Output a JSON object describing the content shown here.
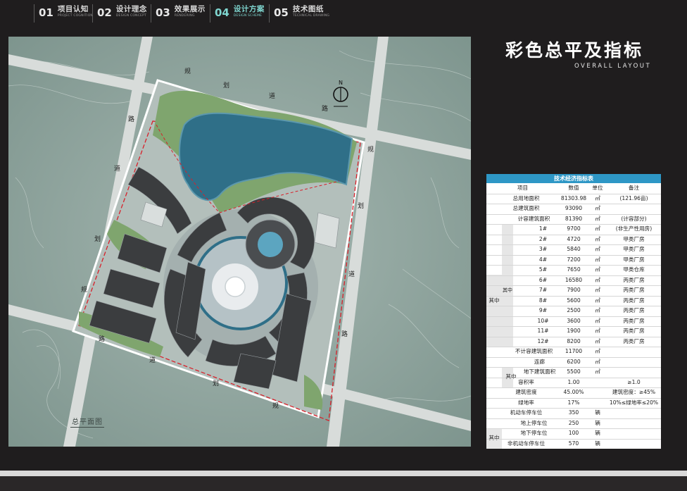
{
  "nav": {
    "items": [
      {
        "num": "01",
        "zh": "项目认知",
        "en": "PROJECT COGNITION"
      },
      {
        "num": "02",
        "zh": "设计理念",
        "en": "DESIGN CONCEPT"
      },
      {
        "num": "03",
        "zh": "效果展示",
        "en": "RENDERING"
      },
      {
        "num": "04",
        "zh": "设计方案",
        "en": "DESIGN SCHEME"
      },
      {
        "num": "05",
        "zh": "技术图纸",
        "en": "TECHNICAL DRAWING"
      }
    ],
    "active_index": 3
  },
  "title": {
    "zh": "彩色总平及指标",
    "en": "OVERALL LAYOUT"
  },
  "plan": {
    "label": "总平面图",
    "compass": "N",
    "road_labels": [
      "规",
      "划",
      "道",
      "路",
      "规",
      "划",
      "道",
      "路",
      "规",
      "划",
      "道",
      "路",
      "规",
      "划",
      "道",
      "路"
    ]
  },
  "table": {
    "title": "技术经济指标表",
    "headers": [
      "项目",
      "数值",
      "单位",
      "备注"
    ],
    "rows": [
      {
        "item": "总用地面积",
        "value": "81303.98",
        "unit": "㎡",
        "note": "(121.96亩)"
      },
      {
        "item": "总建筑面积",
        "value": "93090",
        "unit": "㎡",
        "note": ""
      },
      {
        "item": "计容建筑面积",
        "value": "81390",
        "unit": "㎡",
        "note": "(计容部分)"
      },
      {
        "item": "1#",
        "value": "9700",
        "unit": "㎡",
        "note": "(非生产性用房)"
      },
      {
        "item": "2#",
        "value": "4720",
        "unit": "㎡",
        "note": "甲类厂房"
      },
      {
        "item": "3#",
        "value": "5840",
        "unit": "㎡",
        "note": "甲类厂房"
      },
      {
        "item": "4#",
        "value": "7200",
        "unit": "㎡",
        "note": "甲类厂房"
      },
      {
        "item": "5#",
        "value": "7650",
        "unit": "㎡",
        "note": "甲类仓库"
      },
      {
        "item": "6#",
        "value": "16580",
        "unit": "㎡",
        "note": "丙类厂房"
      },
      {
        "item": "7#",
        "value": "7900",
        "unit": "㎡",
        "note": "丙类厂房"
      },
      {
        "item": "8#",
        "value": "5600",
        "unit": "㎡",
        "note": "丙类厂房"
      },
      {
        "item": "9#",
        "value": "2500",
        "unit": "㎡",
        "note": "丙类厂房"
      },
      {
        "item": "10#",
        "value": "3600",
        "unit": "㎡",
        "note": "丙类厂房"
      },
      {
        "item": "11#",
        "value": "1900",
        "unit": "㎡",
        "note": "丙类厂房"
      },
      {
        "item": "12#",
        "value": "8200",
        "unit": "㎡",
        "note": "丙类厂房"
      },
      {
        "item": "不计容建筑面积",
        "value": "11700",
        "unit": "㎡",
        "note": ""
      },
      {
        "item": "连廊",
        "value": "6200",
        "unit": "㎡",
        "note": ""
      },
      {
        "item": "地下建筑面积",
        "value": "5500",
        "unit": "㎡",
        "note": ""
      },
      {
        "item": "容积率",
        "value": "1.00",
        "unit": "",
        "note": "≥1.0"
      },
      {
        "item": "建筑密度",
        "value": "45.00%",
        "unit": "",
        "note": "建筑密度：≥45%"
      },
      {
        "item": "绿地率",
        "value": "17%",
        "unit": "",
        "note": "10%≤绿地率≤20%"
      },
      {
        "item": "机动车停车位",
        "value": "350",
        "unit": "辆",
        "note": ""
      },
      {
        "item": "地上停车位",
        "value": "250",
        "unit": "辆",
        "note": ""
      },
      {
        "item": "地下停车位",
        "value": "100",
        "unit": "辆",
        "note": ""
      },
      {
        "item": "非机动车停车位",
        "value": "570",
        "unit": "辆",
        "note": ""
      }
    ],
    "group_labels": {
      "qizhong": "其中"
    }
  },
  "colors": {
    "background": "#1f1d1e",
    "accent": "#7fd6d0",
    "table_header": "#2e97c6",
    "water": "#2f6f88",
    "green": "#7fa56e",
    "building": "#3b3d3f"
  }
}
